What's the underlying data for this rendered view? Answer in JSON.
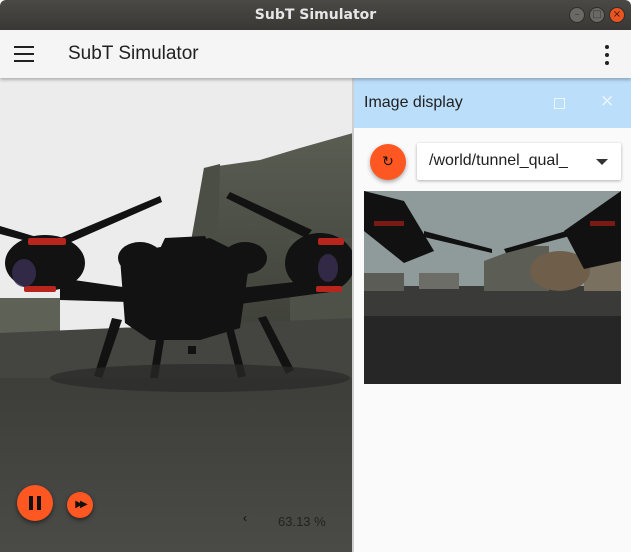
{
  "window": {
    "title": "SubT Simulator",
    "controls": [
      "minimize-icon",
      "maximize-icon",
      "close-icon"
    ]
  },
  "toolbar": {
    "title": "SubT Simulator",
    "menu_icon": "hamburger-menu-icon",
    "more_icon": "more-vert-icon"
  },
  "scene": {
    "play_pause_icon": "pause-icon",
    "fast_forward_icon": "fast-forward-icon",
    "rtf_value": "63.13 %"
  },
  "image_panel": {
    "title": "Image display",
    "refresh_icon": "refresh-icon",
    "topic": "/world/tunnel_qual_",
    "header_color": "#bbdefb"
  },
  "colors": {
    "accent": "#ff5722",
    "titlebar": "#3c3b37"
  }
}
